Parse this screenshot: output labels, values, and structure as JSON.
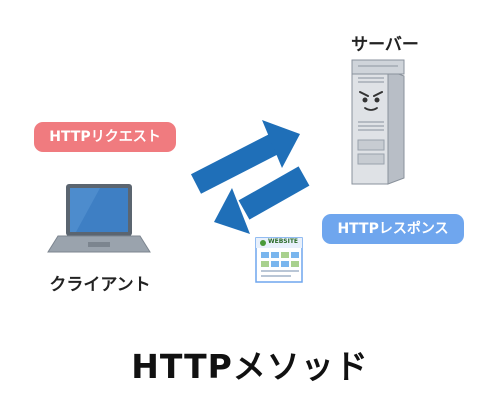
{
  "diagram": {
    "server_label": "サーバー",
    "client_label": "クライアント",
    "request_label": "HTTPリクエスト",
    "response_label": "HTTPレスポンス",
    "title": "HTTPメソッド",
    "website_text": "WEBSITE"
  },
  "colors": {
    "arrow": "#1f6fb8",
    "request_pill": "#f07b7f",
    "response_pill": "#6fa6ee",
    "laptop_screen": "#3e7fc4",
    "laptop_body": "#9aa3ad",
    "server_body": "#dfe2e6"
  },
  "icons": [
    "server-icon",
    "laptop-icon",
    "website-icon",
    "arrow-right-up-icon",
    "arrow-left-down-icon"
  ]
}
